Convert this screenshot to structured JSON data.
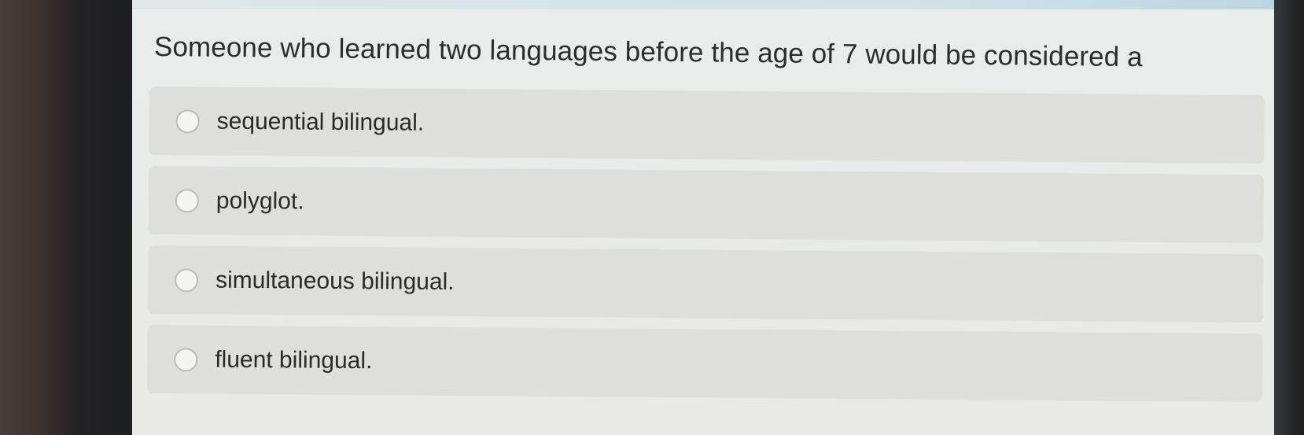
{
  "quiz": {
    "question": "Someone who learned two languages before the age of 7 would be considered a",
    "options": [
      {
        "label": "sequential bilingual.",
        "selected": false
      },
      {
        "label": "polyglot.",
        "selected": false
      },
      {
        "label": "simultaneous bilingual.",
        "selected": false
      },
      {
        "label": "fluent bilingual.",
        "selected": false
      }
    ]
  }
}
